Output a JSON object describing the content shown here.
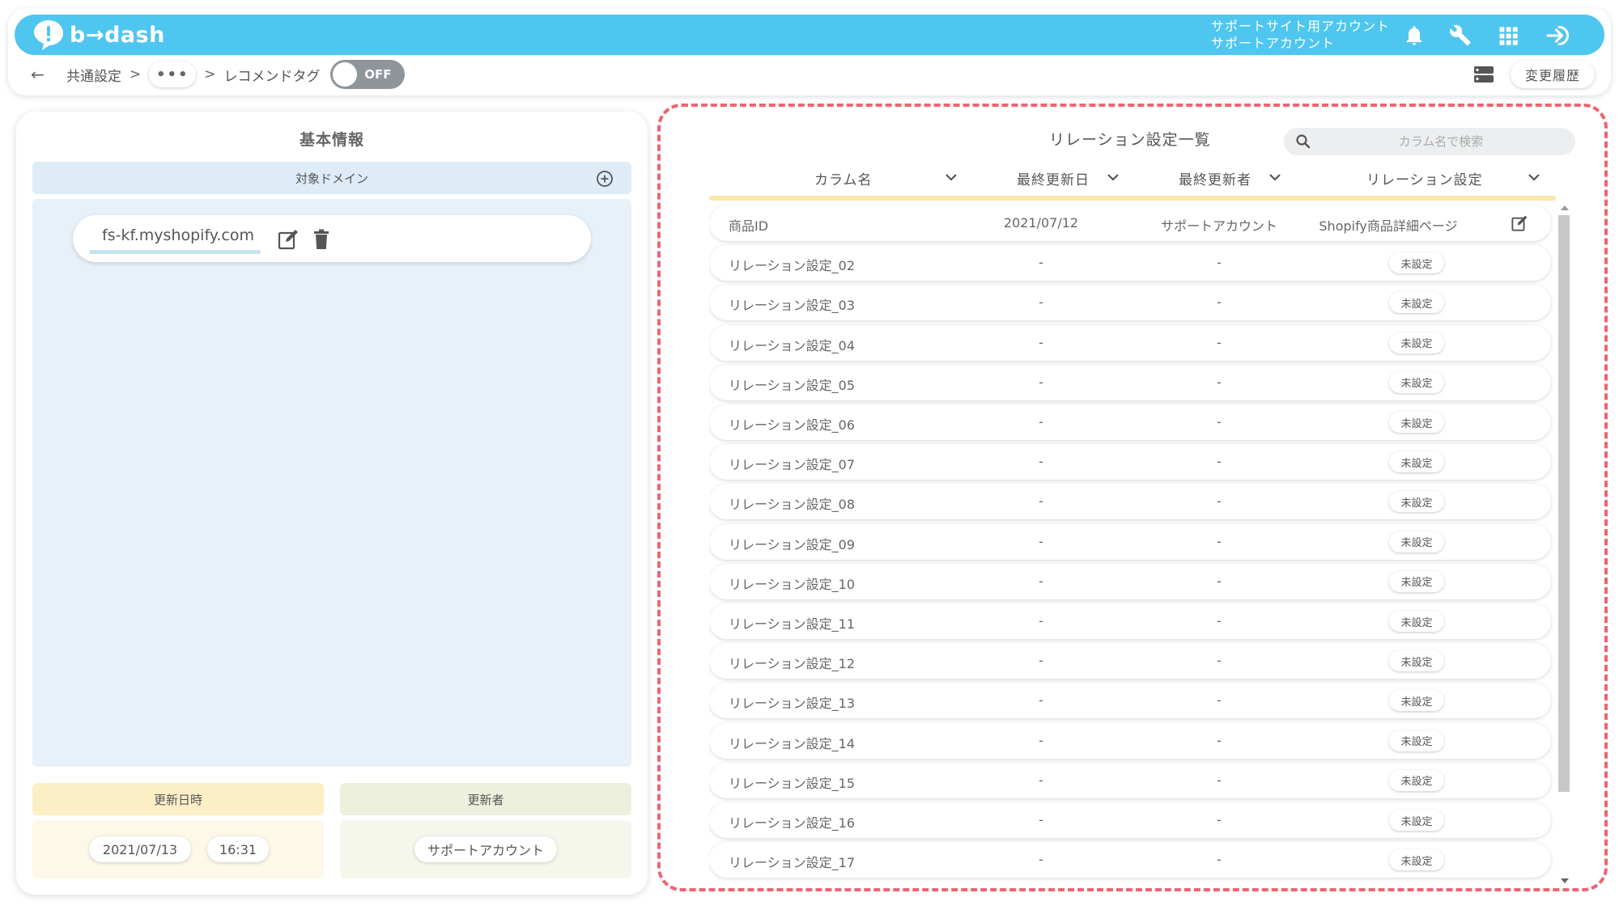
{
  "app": {
    "logo_text": "b→dash",
    "account_line1": "サポートサイト用アカウント",
    "account_line2": "サポートアカウント",
    "accent_color": "#4fc6ef"
  },
  "header_icons": [
    "bell-icon",
    "wrench-icon",
    "grid-icon",
    "logout-icon"
  ],
  "breadcrumb": {
    "back": "←",
    "item1": "共通設定",
    "separator": ">",
    "ellipsis": "•••",
    "current": "レコメンドタグ",
    "toggle_label": "OFF"
  },
  "toolbar": {
    "history_label": "変更履歴"
  },
  "left_panel": {
    "title": "基本情報",
    "domain_header": "対象ドメイン",
    "domain": "fs-kf.myshopify.com",
    "updated_at_label": "更新日時",
    "updated_date": "2021/07/13",
    "updated_time": "16:31",
    "updater_label": "更新者",
    "updater": "サポートアカウント"
  },
  "right_panel": {
    "title": "リレーション設定一覧",
    "search_placeholder": "カラム名で検索",
    "columns": [
      "カラム名",
      "最終更新日",
      "最終更新者",
      "リレーション設定"
    ],
    "rows": [
      {
        "name": "商品ID",
        "date": "2021/07/12",
        "user": "サポートアカウント",
        "relation": "Shopify商品詳細ページ",
        "status": ""
      },
      {
        "name": "リレーション設定_02",
        "date": "-",
        "user": "-",
        "relation": "",
        "status": "未設定"
      },
      {
        "name": "リレーション設定_03",
        "date": "-",
        "user": "-",
        "relation": "",
        "status": "未設定"
      },
      {
        "name": "リレーション設定_04",
        "date": "-",
        "user": "-",
        "relation": "",
        "status": "未設定"
      },
      {
        "name": "リレーション設定_05",
        "date": "-",
        "user": "-",
        "relation": "",
        "status": "未設定"
      },
      {
        "name": "リレーション設定_06",
        "date": "-",
        "user": "-",
        "relation": "",
        "status": "未設定"
      },
      {
        "name": "リレーション設定_07",
        "date": "-",
        "user": "-",
        "relation": "",
        "status": "未設定"
      },
      {
        "name": "リレーション設定_08",
        "date": "-",
        "user": "-",
        "relation": "",
        "status": "未設定"
      },
      {
        "name": "リレーション設定_09",
        "date": "-",
        "user": "-",
        "relation": "",
        "status": "未設定"
      },
      {
        "name": "リレーション設定_10",
        "date": "-",
        "user": "-",
        "relation": "",
        "status": "未設定"
      },
      {
        "name": "リレーション設定_11",
        "date": "-",
        "user": "-",
        "relation": "",
        "status": "未設定"
      },
      {
        "name": "リレーション設定_12",
        "date": "-",
        "user": "-",
        "relation": "",
        "status": "未設定"
      },
      {
        "name": "リレーション設定_13",
        "date": "-",
        "user": "-",
        "relation": "",
        "status": "未設定"
      },
      {
        "name": "リレーション設定_14",
        "date": "-",
        "user": "-",
        "relation": "",
        "status": "未設定"
      },
      {
        "name": "リレーション設定_15",
        "date": "-",
        "user": "-",
        "relation": "",
        "status": "未設定"
      },
      {
        "name": "リレーション設定_16",
        "date": "-",
        "user": "-",
        "relation": "",
        "status": "未設定"
      },
      {
        "name": "リレーション設定_17",
        "date": "-",
        "user": "-",
        "relation": "",
        "status": "未設定"
      }
    ],
    "highlight_color": "#ef6470"
  }
}
